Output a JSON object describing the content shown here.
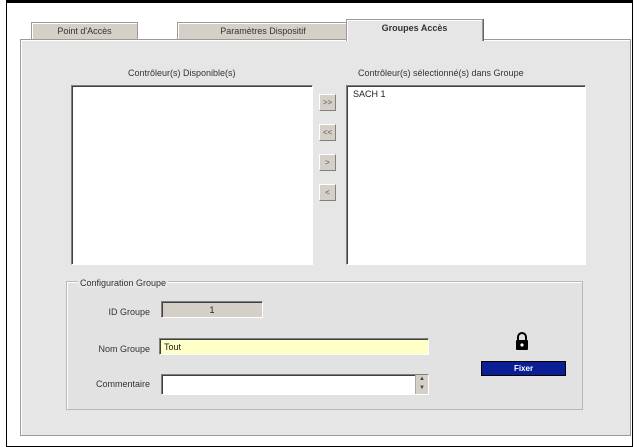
{
  "tabs": [
    {
      "label": "Point d'Accès"
    },
    {
      "label": "Paramètres Dispositif"
    },
    {
      "label": "Groupes Accès"
    }
  ],
  "available": {
    "label": "Contrôleur(s) Disponible(s)",
    "items": []
  },
  "selected": {
    "label": "Contrôleur(s) sélectionné(s) dans Groupe",
    "items": [
      "SACH 1"
    ]
  },
  "move_buttons": {
    "add_all": ">>",
    "remove_all": "<<",
    "add_one": ">",
    "remove_one": "<"
  },
  "group_config": {
    "title": "Configuration Groupe",
    "id_label": "ID Groupe",
    "id_value": "1",
    "name_label": "Nom Groupe",
    "name_value": "Tout",
    "comment_label": "Commentaire",
    "comment_value": ""
  },
  "close_button": {
    "label": "Fixer",
    "icon": "lock-icon"
  },
  "colors": {
    "panel": "#e6e6e6",
    "name_field": "#ffffc8",
    "close_button": "#0b1e93"
  }
}
